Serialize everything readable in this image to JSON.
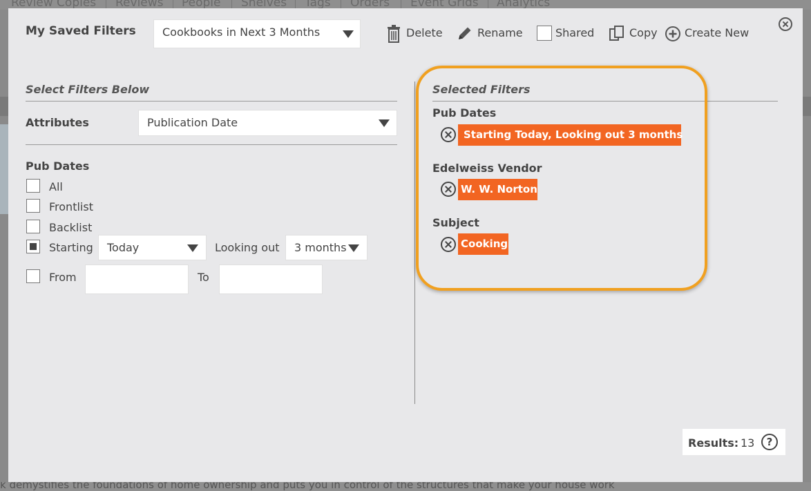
{
  "background": {
    "nav_tabs": [
      "Review Copies",
      "Reviews",
      "People",
      "Shelves",
      "Tags",
      "Orders",
      "Event Grids",
      "Analytics"
    ],
    "footer_text": "k demystifies the foundations of home ownership and puts you in control of the structures that make your house work"
  },
  "modal": {
    "title": "My Saved Filters",
    "saved_filter_select": {
      "value": "Cookbooks in Next 3 Months"
    },
    "toolbar": {
      "delete_label": "Delete",
      "rename_label": "Rename",
      "shared_label": "Shared",
      "copy_label": "Copy",
      "create_new_label": "Create New"
    }
  },
  "left_panel": {
    "heading": "Select Filters Below",
    "attributes_label": "Attributes",
    "attributes_select": {
      "value": "Publication Date"
    },
    "pub_dates_heading": "Pub Dates",
    "options": {
      "all": "All",
      "frontlist": "Frontlist",
      "backlist": "Backlist",
      "starting": "Starting",
      "from": "From"
    },
    "starting_select": {
      "value": "Today"
    },
    "looking_out_label": "Looking out",
    "looking_out_select": {
      "value": "3 months"
    },
    "to_label": "To",
    "checked": {
      "all": false,
      "frontlist": false,
      "backlist": false,
      "starting": true,
      "from": false
    }
  },
  "right_panel": {
    "heading": "Selected Filters",
    "groups": [
      {
        "name": "Pub Dates",
        "tag": "Starting Today, Looking out 3 months"
      },
      {
        "name": "Edelweiss Vendor",
        "tag": "W. W. Norton"
      },
      {
        "name": "Subject",
        "tag": "Cooking"
      }
    ]
  },
  "results": {
    "label": "Results:",
    "count": "13"
  },
  "colors": {
    "tag_bg": "#f26522",
    "highlight_border": "#f0a020",
    "modal_bg": "#e8e8ea"
  }
}
